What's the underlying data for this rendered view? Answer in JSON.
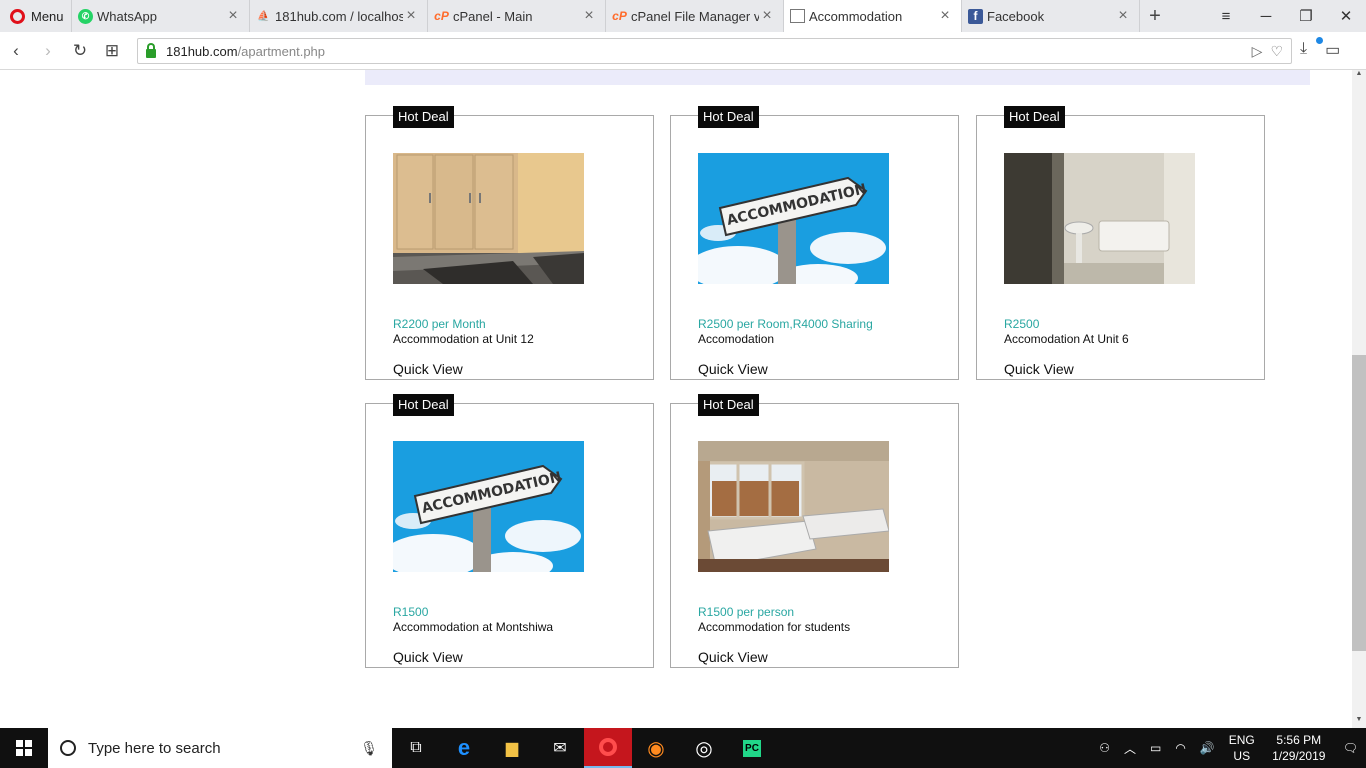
{
  "browser": {
    "menu_label": "Menu",
    "tabs": [
      {
        "title": "WhatsApp",
        "icon": "whatsapp-icon",
        "active": false
      },
      {
        "title": "181hub.com / localhost",
        "icon": "phpmyadmin-icon",
        "active": false
      },
      {
        "title": "cPanel - Main",
        "icon": "cpanel-icon",
        "active": false
      },
      {
        "title": "cPanel File Manager v3",
        "icon": "cpanel-icon",
        "active": false
      },
      {
        "title": "Accommodation",
        "icon": "document-icon",
        "active": true
      },
      {
        "title": "Facebook",
        "icon": "facebook-icon",
        "active": false
      }
    ],
    "url_host": "181hub.com",
    "url_path": "/apartment.php"
  },
  "listings": [
    {
      "badge": "Hot Deal",
      "price": "R2200 per Month",
      "name": "Accommodation at Unit 12",
      "quick_view": "Quick View",
      "image": "bedroom-wardrobe"
    },
    {
      "badge": "Hot Deal",
      "price": "R2500 per Room,R4000 Sharing",
      "name": "Accomodation",
      "quick_view": "Quick View",
      "image": "accommodation-sign"
    },
    {
      "badge": "Hot Deal",
      "price": "R2500",
      "name": "Accomodation At Unit 6",
      "quick_view": "Quick View",
      "image": "bathroom"
    },
    {
      "badge": "Hot Deal",
      "price": "R1500",
      "name": "Accommodation at Montshiwa",
      "quick_view": "Quick View",
      "image": "accommodation-sign"
    },
    {
      "badge": "Hot Deal",
      "price": "R1500 per person",
      "name": "Accommodation for students",
      "quick_view": "Quick View",
      "image": "bedroom-beds"
    }
  ],
  "taskbar": {
    "search_placeholder": "Type here to search",
    "lang_top": "ENG",
    "lang_bottom": "US",
    "time": "5:56 PM",
    "date": "1/29/2019"
  },
  "colors": {
    "price": "#2aa7a2",
    "badge_bg": "#0a0a0a",
    "band": "#ebebfa"
  }
}
